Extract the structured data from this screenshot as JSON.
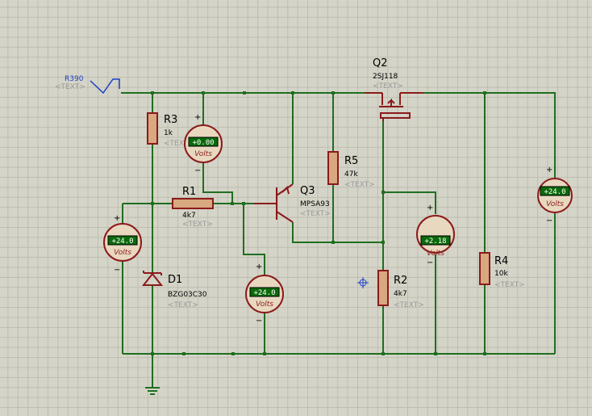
{
  "generator": {
    "ref": "R390",
    "text": "<TEXT>"
  },
  "components": {
    "R3": {
      "ref": "R3",
      "value": "1k",
      "text": "<TEXT>"
    },
    "R1": {
      "ref": "R1",
      "value": "4k7",
      "text": "<TEXT>"
    },
    "R5": {
      "ref": "R5",
      "value": "47k",
      "text": "<TEXT>"
    },
    "R2": {
      "ref": "R2",
      "value": "4k7",
      "text": "<TEXT>"
    },
    "R4": {
      "ref": "R4",
      "value": "10k",
      "text": "<TEXT>"
    },
    "D1": {
      "ref": "D1",
      "value": "BZG03C30",
      "text": "<TEXT>"
    },
    "Q2": {
      "ref": "Q2",
      "value": "2SJ118",
      "text": "<TEXT>"
    },
    "Q3": {
      "ref": "Q3",
      "value": "MPSA93",
      "text": "<TEXT>"
    }
  },
  "meters": [
    {
      "id": "vm-r3",
      "reading": "+0.00",
      "unit": "Volts"
    },
    {
      "id": "vm-d1",
      "reading": "+24.0",
      "unit": "Volts"
    },
    {
      "id": "vm-r1",
      "reading": "+24.0",
      "unit": "Volts"
    },
    {
      "id": "vm-r2",
      "reading": "+2.18",
      "unit": "Volts"
    },
    {
      "id": "vm-r4",
      "reading": "+24.0",
      "unit": "Volts"
    }
  ],
  "plus_sign": "+",
  "minus_sign": "−"
}
